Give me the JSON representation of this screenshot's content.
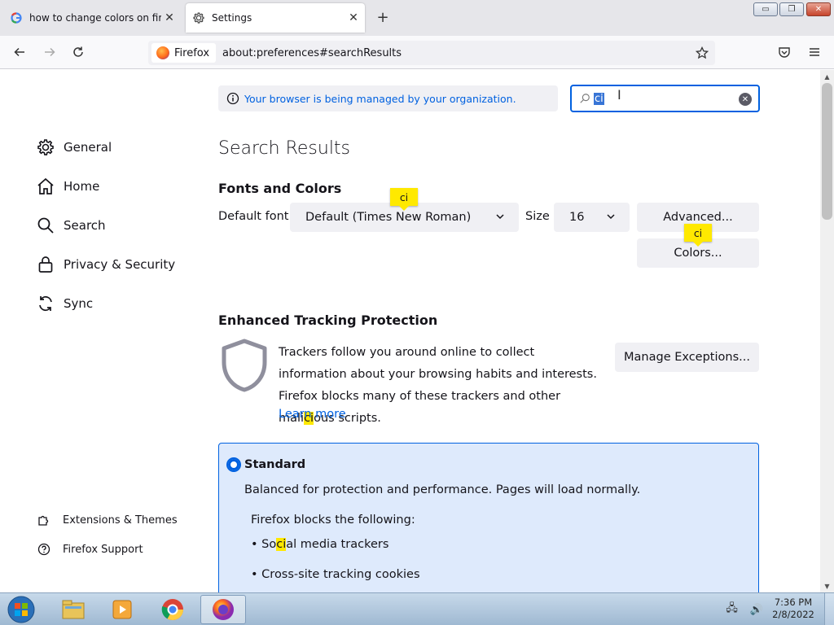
{
  "tabs": [
    {
      "title": "how to change colors on firefo",
      "favicon": "google-icon",
      "active": false
    },
    {
      "title": "Settings",
      "favicon": "gear-icon",
      "active": true
    }
  ],
  "window": {
    "min": "▭",
    "max": "❐",
    "close": "✕"
  },
  "nav": {
    "identity_label": "Firefox",
    "url": "about:preferences#searchResults"
  },
  "sidebar": {
    "categories": [
      {
        "label": "General",
        "icon": "gear-icon"
      },
      {
        "label": "Home",
        "icon": "home-icon"
      },
      {
        "label": "Search",
        "icon": "search-icon"
      },
      {
        "label": "Privacy & Security",
        "icon": "lock-icon"
      },
      {
        "label": "Sync",
        "icon": "sync-icon"
      }
    ],
    "footer": [
      {
        "label": "Extensions & Themes",
        "icon": "puzzle-icon"
      },
      {
        "label": "Firefox Support",
        "icon": "help-icon"
      }
    ]
  },
  "managed_notice": "Your browser is being managed by your organization.",
  "search": {
    "value": "ci"
  },
  "results_title": "Search Results",
  "fonts": {
    "heading": "Fonts and Colors",
    "default_font_label": "Default font",
    "default_font_value": "Default (Times New Roman)",
    "size_label": "Size",
    "size_value": "16",
    "advanced_label": "Advanced...",
    "colors_label": "Colors...",
    "highlight_popup": "ci"
  },
  "etp": {
    "heading": "Enhanced Tracking Protection",
    "desc_before": "Trackers follow you around online to collect information about your browsing habits and interests. Firefox blocks many of these trackers and other mali",
    "desc_hl": "ci",
    "desc_after": "ous scripts.",
    "learn_more": "Learn more",
    "manage_exceptions": "Manage Exceptions...",
    "standard": {
      "label": "Standard",
      "desc": "Balanced for protection and performance. Pages will load normally.",
      "blocks_heading": "Firefox blocks the following:",
      "items": [
        {
          "before": "So",
          "hl": "ci",
          "after": "al media trackers"
        },
        {
          "before": "Cross-site tracking cookies",
          "hl": "",
          "after": ""
        }
      ]
    }
  },
  "taskbar": {
    "time": "7:36 PM",
    "date": "2/8/2022"
  },
  "colors": {
    "accent": "#0061e0",
    "highlight": "#ffe900",
    "standard_bg": "#deeafc"
  }
}
